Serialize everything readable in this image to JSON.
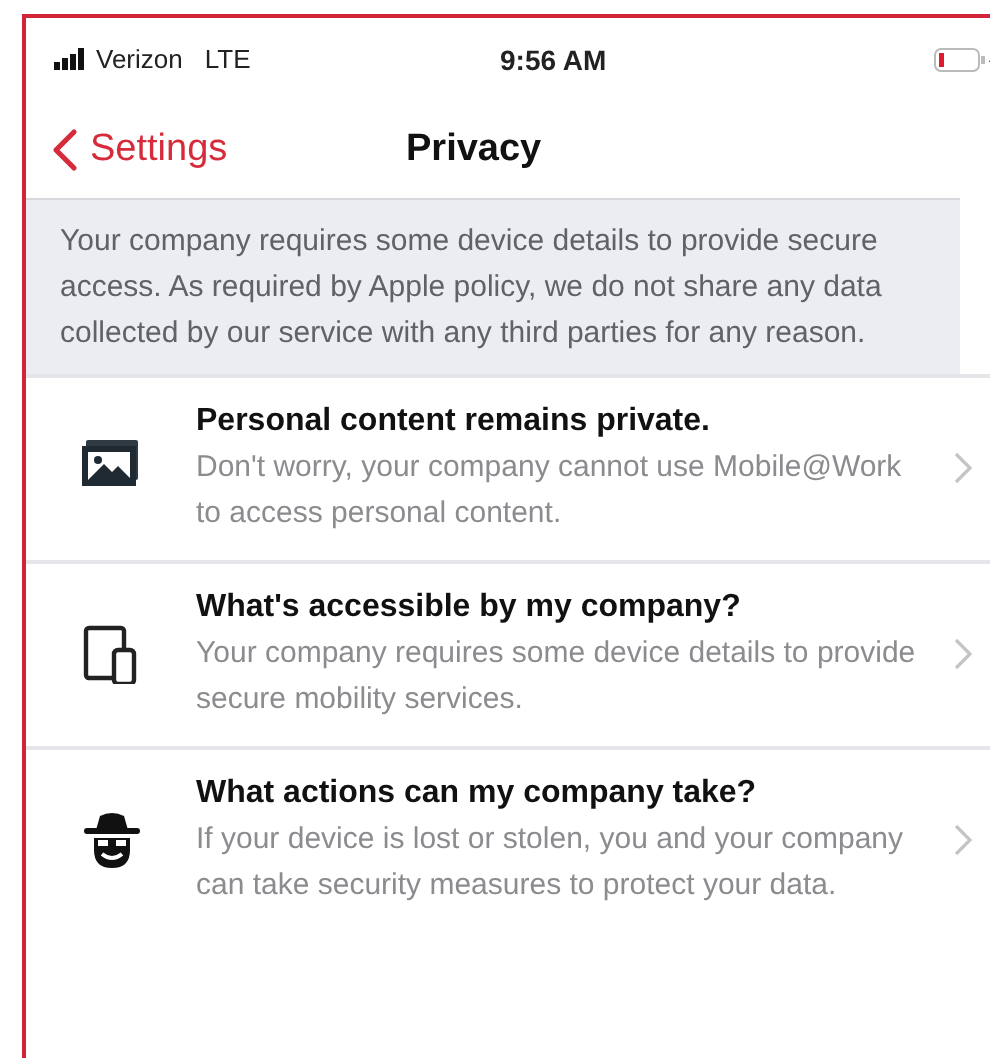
{
  "status_bar": {
    "carrier": "Verizon",
    "network": "LTE",
    "time": "9:56 AM"
  },
  "nav": {
    "back": "Settings",
    "title": "Privacy"
  },
  "notice": "Your company requires some device details to provide secure access. As required by Apple policy, we do not share any data collected by our service with any third parties for any reason.",
  "items": [
    {
      "kind": "photo",
      "title": "Personal content remains private.",
      "description": "Don't worry, your company cannot use Mobile@Work to access personal content."
    },
    {
      "kind": "devices",
      "title": "What's accessible by my company?",
      "description": "Your company requires some device details to provide secure mobility services."
    },
    {
      "kind": "spy",
      "title": "What actions can my company take?",
      "description": "If your device is lost or stolen, you and your company can take security measures to protect your data."
    }
  ]
}
